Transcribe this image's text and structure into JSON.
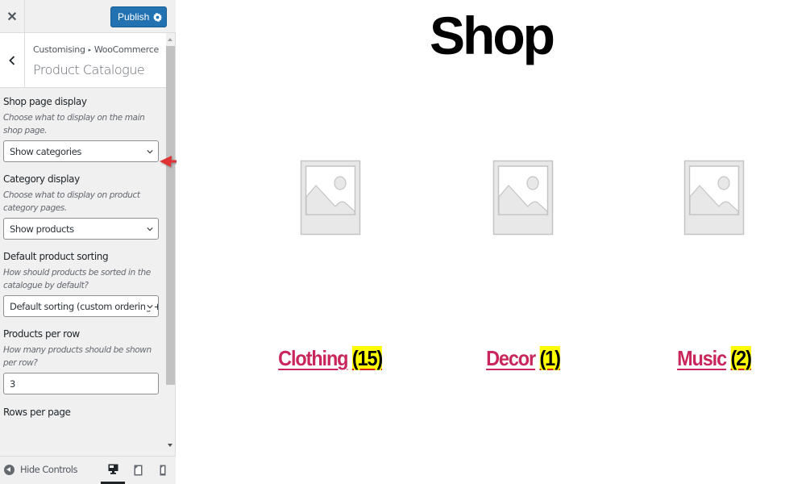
{
  "topbar": {
    "close_icon": "close-icon",
    "publish_label": "Publish",
    "settings_icon": "gear-icon"
  },
  "panel": {
    "breadcrumb_root": "Customising",
    "breadcrumb_separator": "▸",
    "breadcrumb_section": "WooCommerce",
    "title": "Product Catalogue"
  },
  "controls": {
    "shop_page_display": {
      "label": "Shop page display",
      "description": "Choose what to display on the main shop page.",
      "value": "Show categories"
    },
    "category_display": {
      "label": "Category display",
      "description": "Choose what to display on product category pages.",
      "value": "Show products"
    },
    "default_sorting": {
      "label": "Default product sorting",
      "description": "How should products be sorted in the catalogue by default?",
      "value": "Default sorting (custom ordering + name)"
    },
    "products_per_row": {
      "label": "Products per row",
      "description": "How many products should be shown per row?",
      "value": "3"
    },
    "rows_per_page": {
      "label": "Rows per page"
    }
  },
  "footer": {
    "hide_controls_label": "Hide Controls",
    "devices": [
      "desktop",
      "tablet",
      "mobile"
    ],
    "active_device": "desktop"
  },
  "preview": {
    "page_title": "Shop",
    "categories": [
      {
        "name": "Clothing",
        "count": "(15)"
      },
      {
        "name": "Decor",
        "count": "(1)"
      },
      {
        "name": "Music",
        "count": "(2)"
      }
    ]
  },
  "colors": {
    "publish_blue": "#2271b1",
    "category_link": "#c9265b",
    "count_highlight": "#ffff00",
    "annotation_arrow": "#e03131"
  }
}
